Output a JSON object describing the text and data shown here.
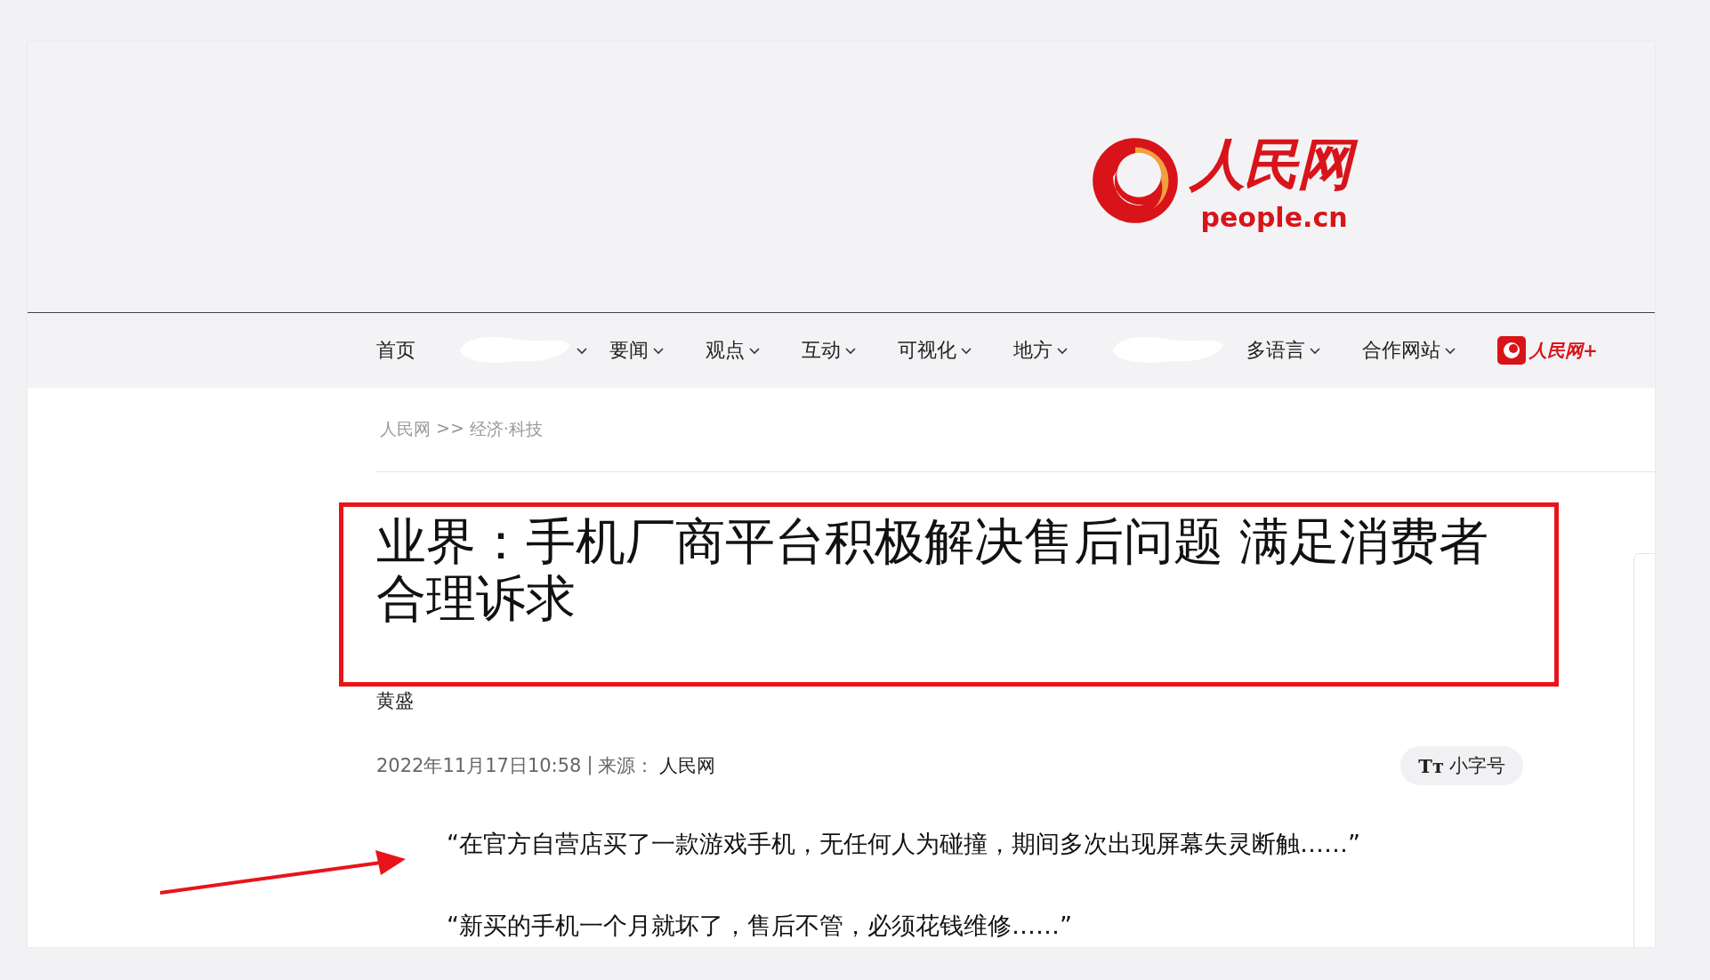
{
  "header": {
    "logo": {
      "wordmark": "人民网",
      "domain": "people.cn"
    }
  },
  "nav": {
    "items": [
      {
        "kind": "link",
        "label": "首页",
        "dropdown": false
      },
      {
        "kind": "redacted",
        "dropdown": true
      },
      {
        "kind": "link",
        "label": "要闻",
        "dropdown": true
      },
      {
        "kind": "link",
        "label": "观点",
        "dropdown": true
      },
      {
        "kind": "link",
        "label": "互动",
        "dropdown": true
      },
      {
        "kind": "link",
        "label": "可视化",
        "dropdown": true
      },
      {
        "kind": "link",
        "label": "地方",
        "dropdown": true
      },
      {
        "kind": "redacted",
        "dropdown": false
      },
      {
        "kind": "link",
        "label": "多语言",
        "dropdown": true
      },
      {
        "kind": "link",
        "label": "合作网站",
        "dropdown": true
      },
      {
        "kind": "app",
        "label": "人民网+",
        "dropdown": false
      }
    ]
  },
  "breadcrumb": [
    "人民网",
    ">>",
    "经济·科技"
  ],
  "article": {
    "title": "业界：手机厂商平台积极解决售后问题 满足消费者合理诉求",
    "author": "黄盛",
    "date": "2022年11月17日10:58",
    "separator": "|",
    "source_label": "来源：",
    "source": "人民网",
    "font_button": {
      "icon": "Tт",
      "label": "小字号"
    },
    "paragraphs": [
      "“在官方自营店买了一款游戏手机，无任何人为碰撞，期间多次出现屏幕失灵断触……”",
      "“新买的手机一个月就坏了，售后不管，必须花钱维修……”"
    ]
  }
}
